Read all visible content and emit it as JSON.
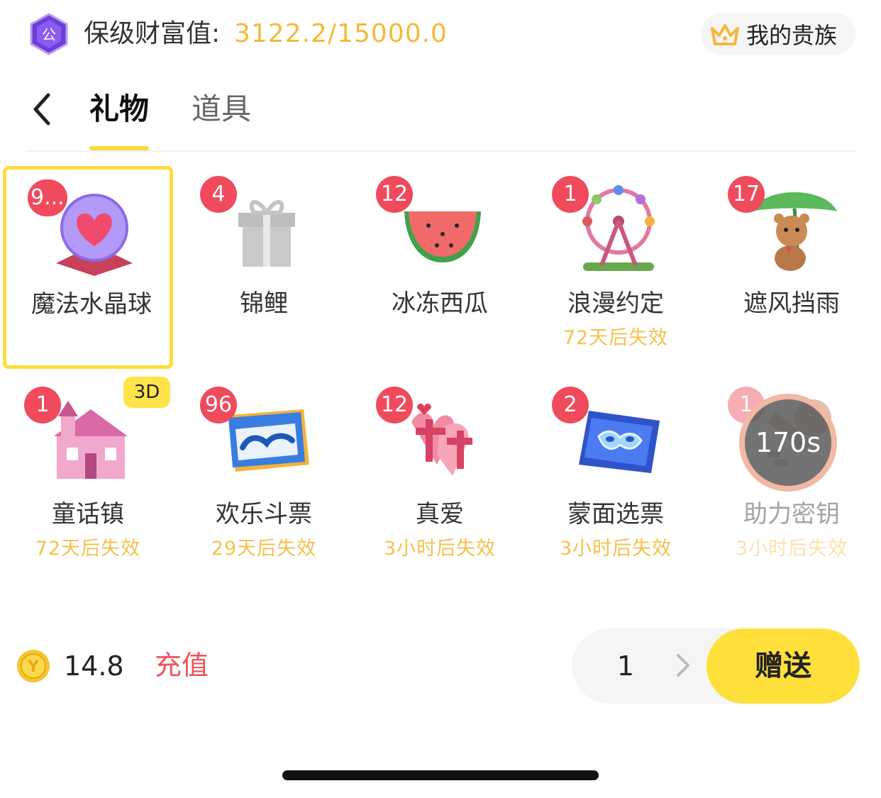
{
  "header": {
    "guard_label": "保级财富值:",
    "guard_value": "3122.2/15000.0",
    "noble_label": "我的贵族"
  },
  "tabs": [
    {
      "label": "礼物",
      "active": true
    },
    {
      "label": "道具",
      "active": false
    }
  ],
  "gifts": [
    {
      "name": "魔法水晶球",
      "count": "9...",
      "expire": "",
      "icon": "crystal-ball-icon",
      "selected": true
    },
    {
      "name": "锦鲤",
      "count": "4",
      "expire": "",
      "icon": "gift-box-icon"
    },
    {
      "name": "冰冻西瓜",
      "count": "12",
      "expire": "",
      "icon": "watermelon-icon"
    },
    {
      "name": "浪漫约定",
      "count": "1",
      "expire": "72天后失效",
      "icon": "ferris-wheel-icon"
    },
    {
      "name": "遮风挡雨",
      "count": "17",
      "expire": "",
      "icon": "bear-leaf-icon"
    },
    {
      "name": "童话镇",
      "count": "1",
      "expire": "72天后失效",
      "icon": "castle-icon",
      "tag": "3D"
    },
    {
      "name": "欢乐斗票",
      "count": "96",
      "expire": "29天后失效",
      "icon": "ticket-icon"
    },
    {
      "name": "真爱",
      "count": "12",
      "expire": "3小时后失效",
      "icon": "true-love-icon"
    },
    {
      "name": "蒙面选票",
      "count": "2",
      "expire": "3小时后失效",
      "icon": "mask-ticket-icon"
    },
    {
      "name": "助力密钥",
      "count": "1",
      "expire": "3小时后失效",
      "icon": "key-icon",
      "cooldown": "170s",
      "disabled": true
    }
  ],
  "footer": {
    "balance": "14.8",
    "recharge_label": "充值",
    "quantity": "1",
    "send_label": "赠送"
  },
  "colors": {
    "accent_yellow": "#ffe03a",
    "badge_red": "#ef4b5d",
    "expire_gold": "#f4c14e",
    "recharge_red": "#f05358"
  }
}
